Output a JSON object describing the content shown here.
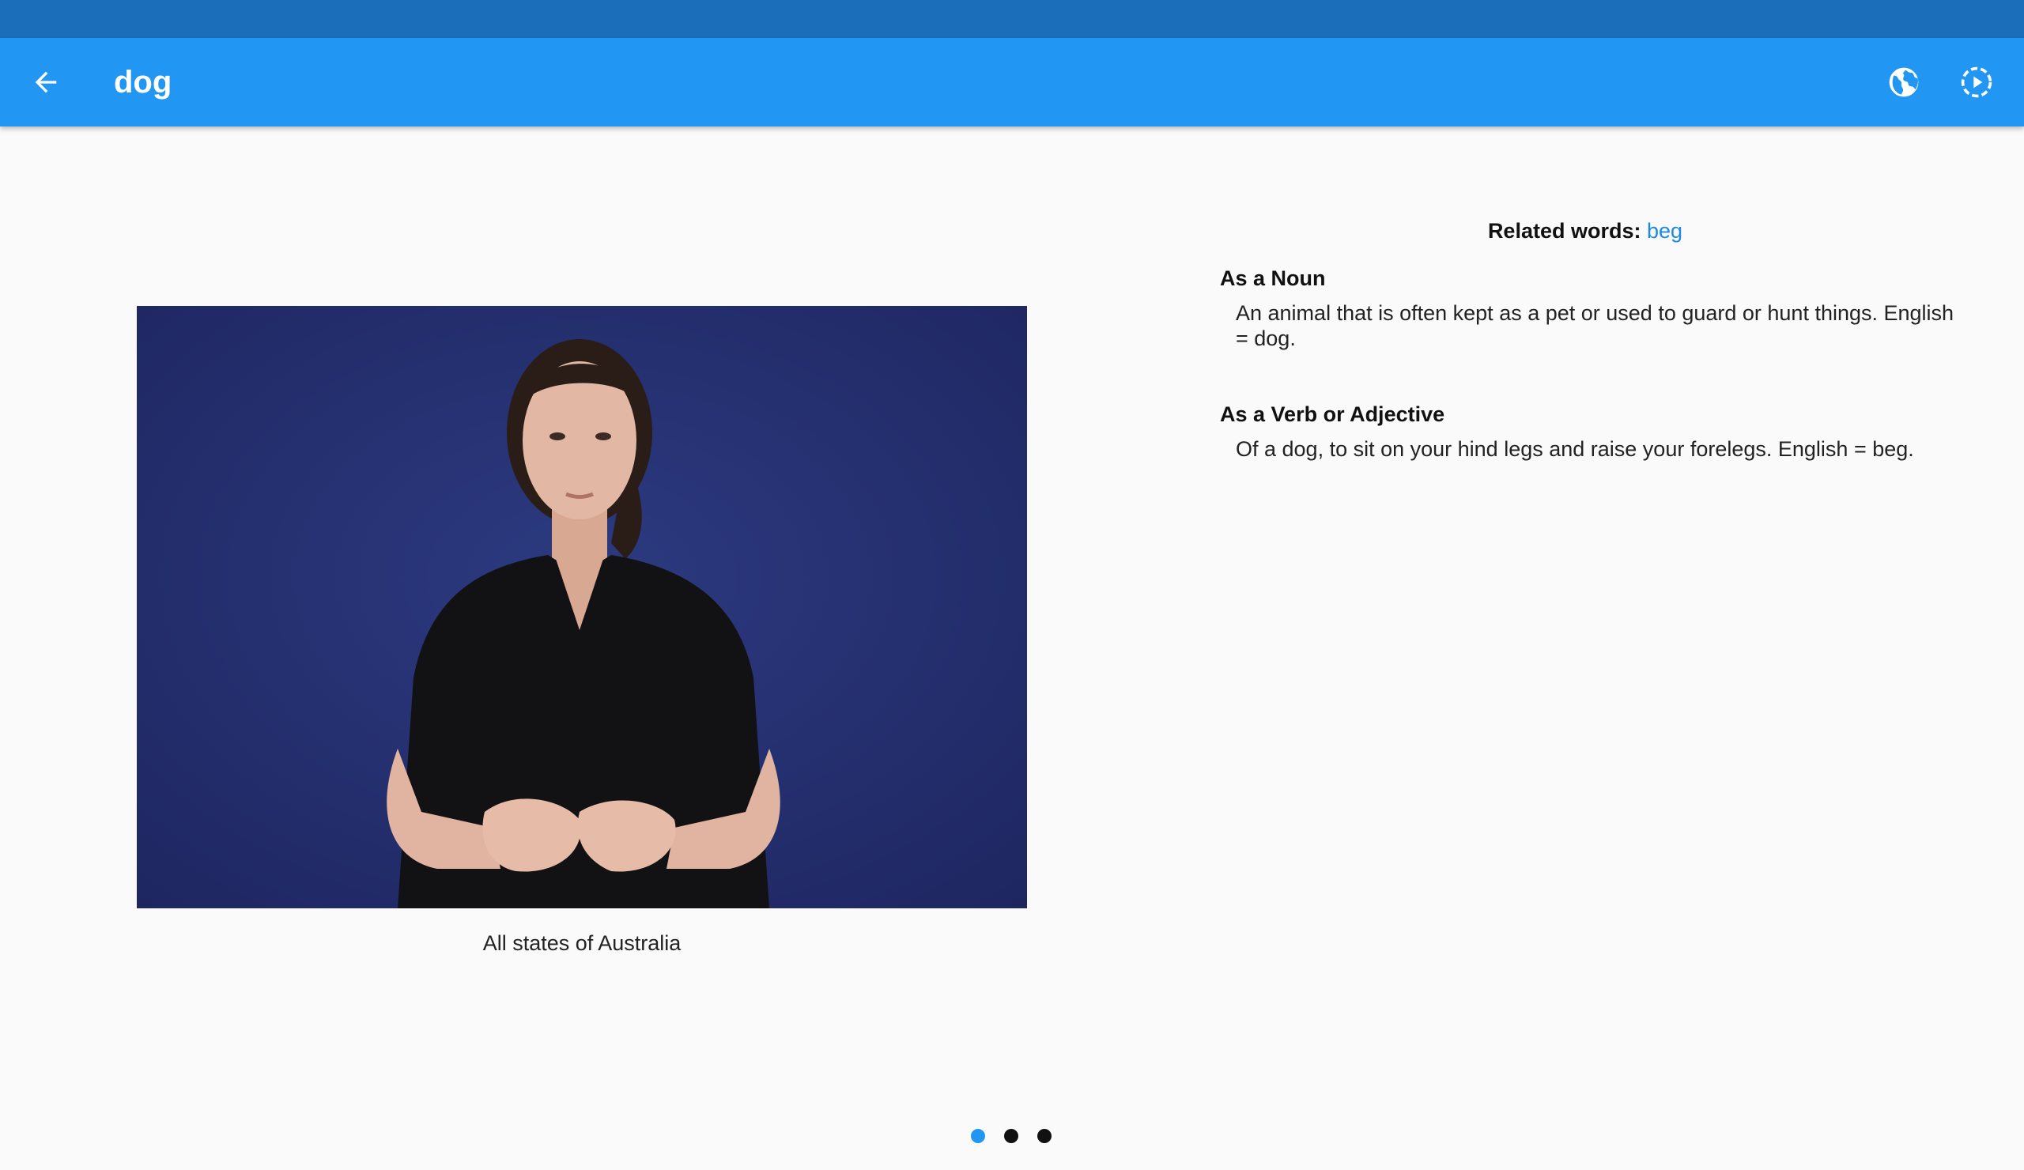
{
  "app_bar": {
    "title": "dog",
    "back_icon": "arrow-back-icon",
    "actions": [
      "globe-icon",
      "play-circle-icon"
    ]
  },
  "colors": {
    "status_bar": "#1b6fba",
    "app_bar": "#2196f3",
    "link": "#1e88e5",
    "video_background": "#273272",
    "active_dot": "#2196f3"
  },
  "video": {
    "caption": "All states of Australia"
  },
  "definitions": {
    "related_label": "Related words:",
    "related_word": "beg",
    "sections": [
      {
        "title": "As a Noun",
        "body": "An animal that is often kept as a pet or used to guard or hunt things. English = dog."
      },
      {
        "title": "As a Verb or Adjective",
        "body": "Of a dog, to sit on your hind legs and raise your forelegs. English = beg."
      }
    ]
  },
  "pager": {
    "count": 3,
    "active_index": 0
  }
}
